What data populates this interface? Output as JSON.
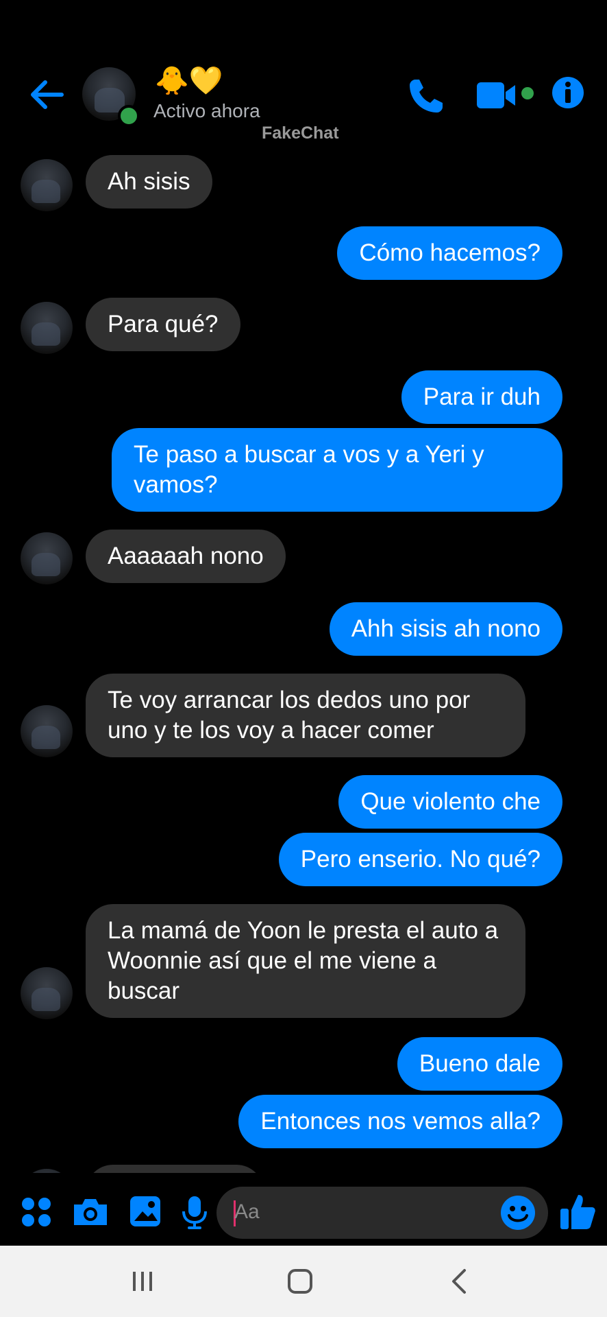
{
  "header": {
    "contact_name": "🐥💛",
    "status": "Activo ahora",
    "watermark": "FakeChat",
    "icons": [
      "back-arrow-icon",
      "phone-icon",
      "video-camera-icon",
      "info-icon"
    ],
    "accent": "#0084ff"
  },
  "messages": [
    {
      "side": "in",
      "text": "Ah sisis"
    },
    {
      "side": "out",
      "text": "Cómo hacemos?"
    },
    {
      "side": "in",
      "text": "Para qué?"
    },
    {
      "side": "out",
      "text": "Para ir duh"
    },
    {
      "side": "out",
      "text": "Te paso a buscar a vos y a Yeri y vamos?"
    },
    {
      "side": "in",
      "text": "Aaaaaah nono"
    },
    {
      "side": "out",
      "text": "Ahh sisis ah nono"
    },
    {
      "side": "in",
      "text": "Te voy arrancar los dedos uno por uno y te los voy a hacer comer"
    },
    {
      "side": "out",
      "text": "Que violento che"
    },
    {
      "side": "out",
      "text": "Pero enserio. No qué?"
    },
    {
      "side": "in",
      "text": "La mamá de Yoon le presta el auto a Woonnie así que el me viene a buscar"
    },
    {
      "side": "out",
      "text": "Bueno dale"
    },
    {
      "side": "out",
      "text": "Entonces nos vemos alla?"
    }
  ],
  "composer": {
    "placeholder": "Aa",
    "icons": [
      "apps-grid-icon",
      "camera-icon",
      "image-icon",
      "microphone-icon",
      "emoji-icon",
      "thumbs-up-icon"
    ]
  },
  "navbar": {
    "icons": [
      "recent-apps-icon",
      "home-icon",
      "back-icon"
    ]
  }
}
